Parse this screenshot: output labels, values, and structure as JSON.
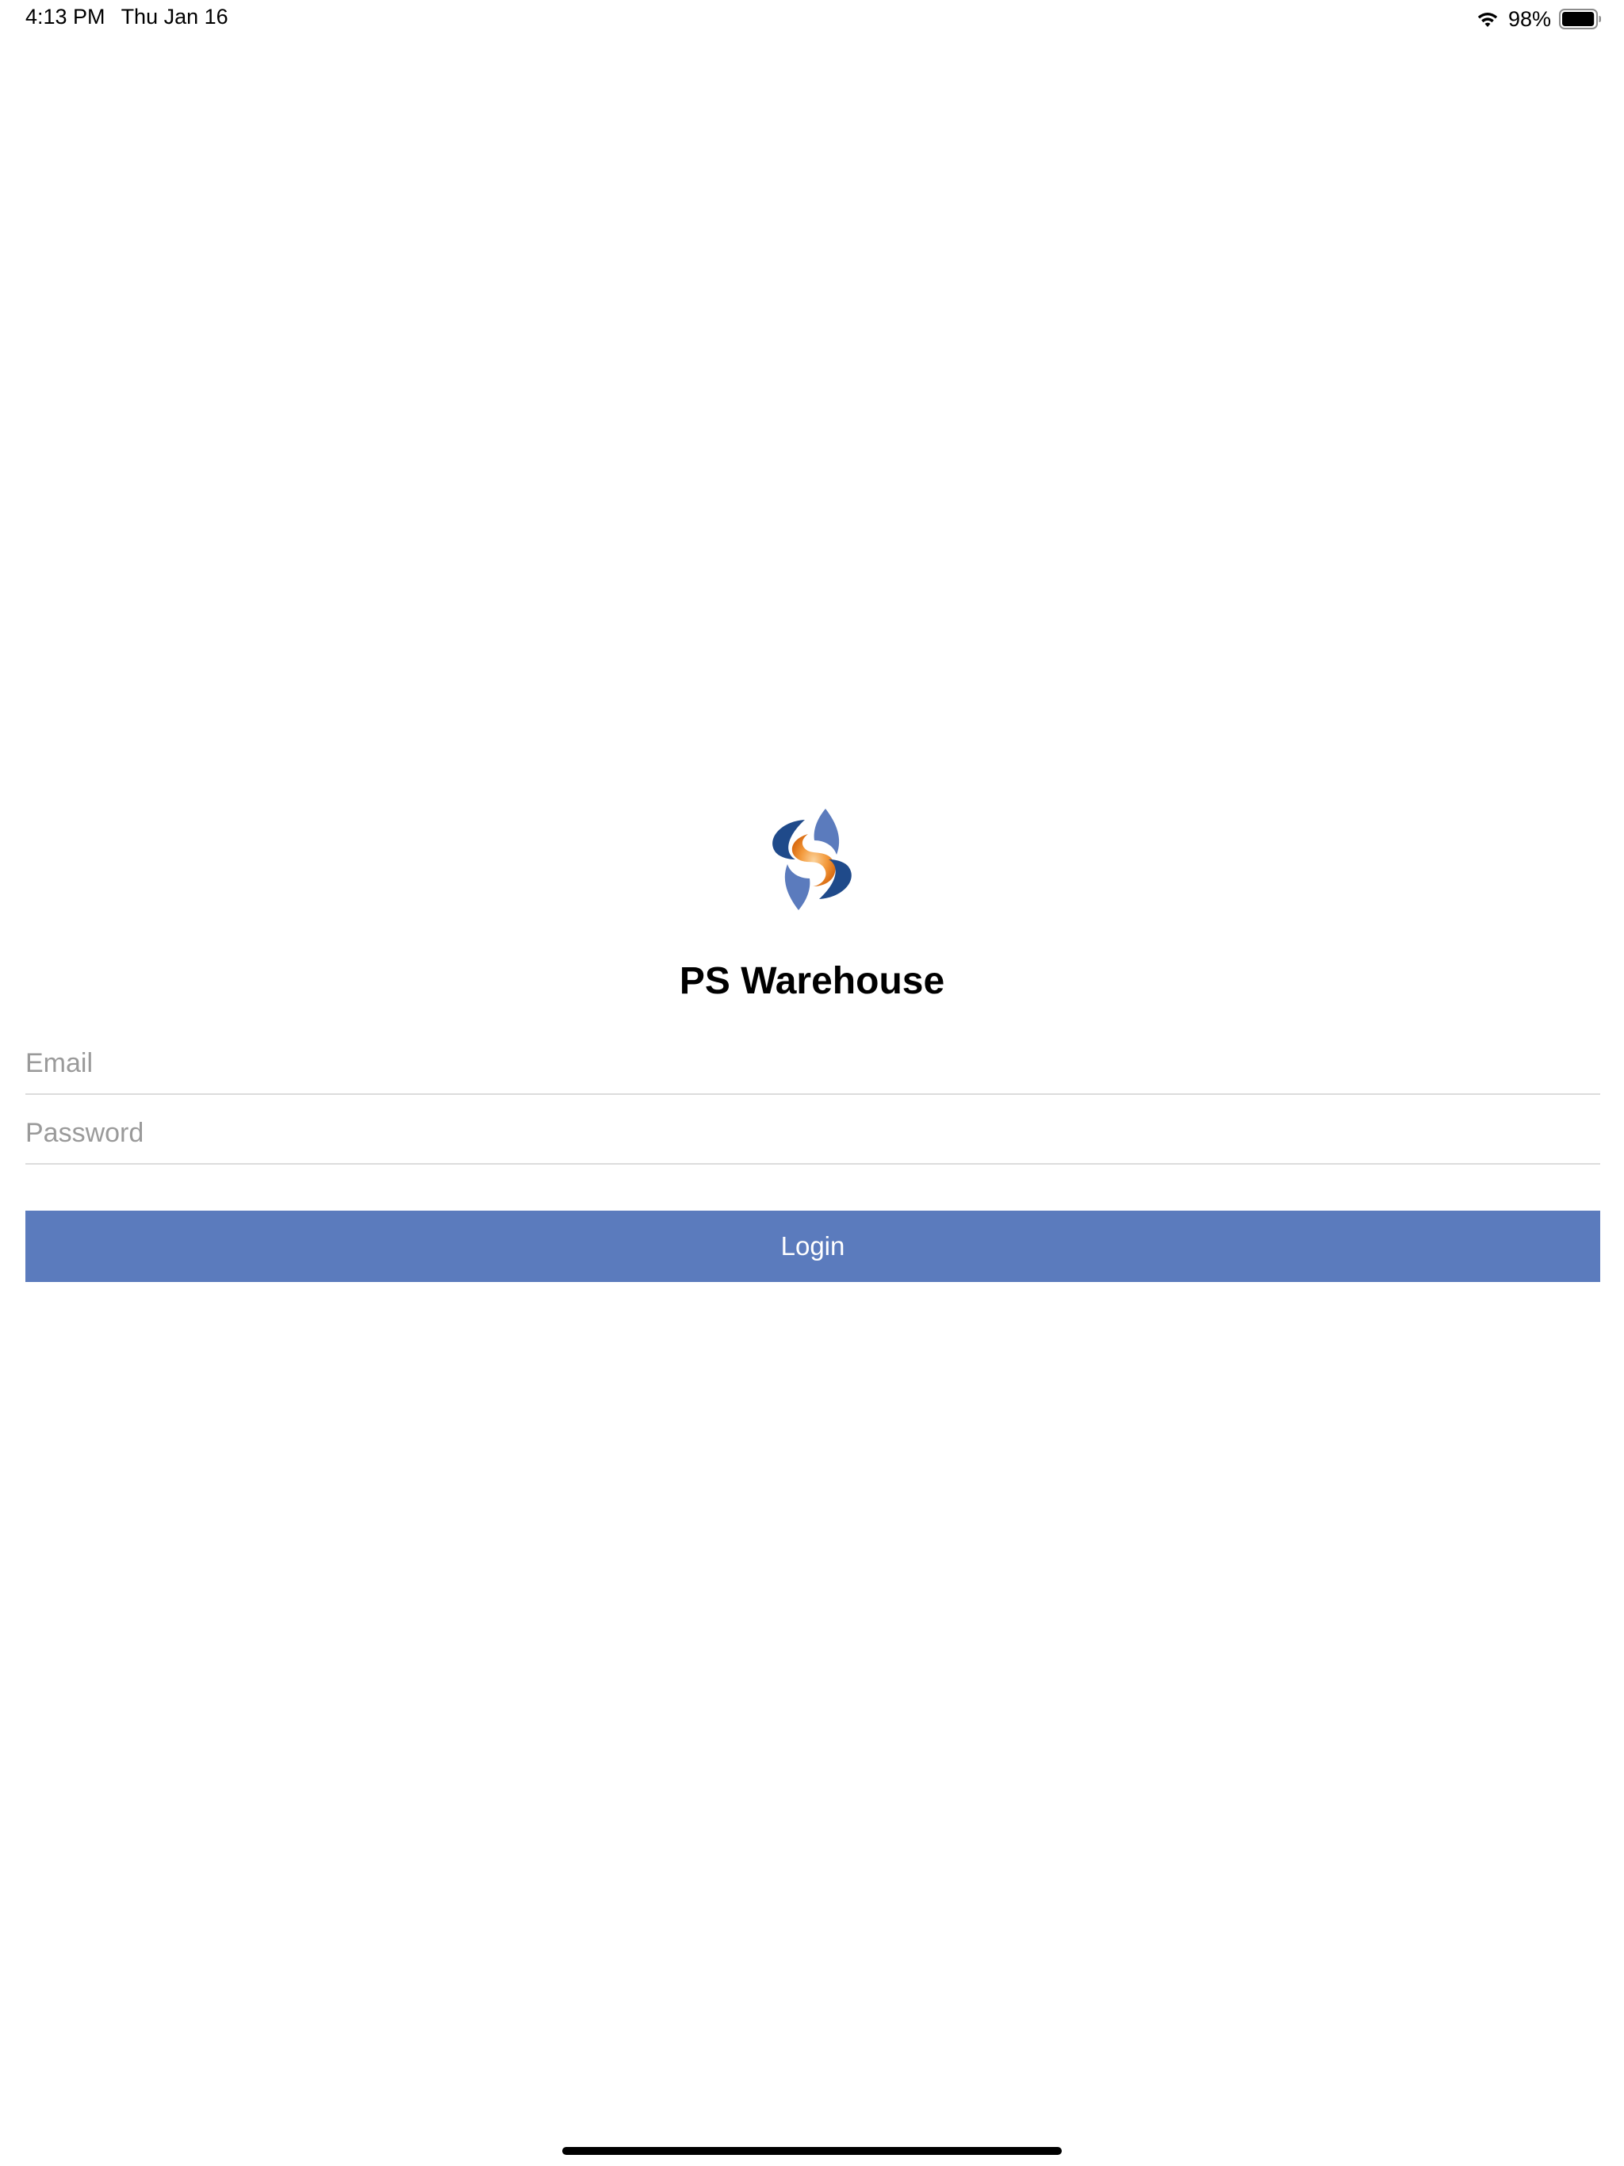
{
  "status_bar": {
    "time": "4:13 PM",
    "date": "Thu Jan 16",
    "battery_percent": "98%",
    "wifi_icon": "wifi-icon",
    "battery_icon": "battery-icon",
    "battery_level": 0.98
  },
  "app": {
    "logo_icon": "swirl-logo-icon",
    "title": "PS Warehouse"
  },
  "login_form": {
    "email": {
      "placeholder": "Email",
      "value": ""
    },
    "password": {
      "placeholder": "Password",
      "value": ""
    },
    "login_label": "Login"
  },
  "colors": {
    "login_button_bg": "#5b7bbd",
    "logo_blue_dark": "#1f4a8a",
    "logo_blue_light": "#5b7bbd",
    "logo_orange": "#f08a24",
    "placeholder_text": "#9a9a9a",
    "divider": "#dcdcdc"
  }
}
